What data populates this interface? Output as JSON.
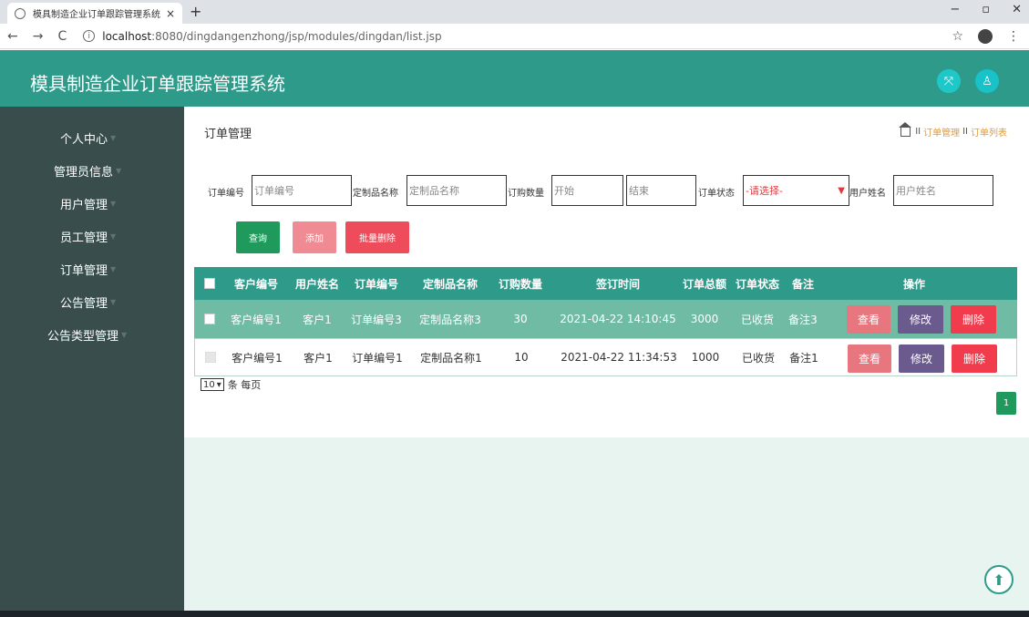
{
  "browser": {
    "tab_title": "模具制造企业订单跟踪管理系统",
    "tab_close": "×",
    "new_tab": "+",
    "url_host": "localhost",
    "url_rest": ":8080/dingdangenzhong/jsp/modules/dingdan/list.jsp",
    "win_min": "−",
    "win_max": "▫",
    "win_close": "✕"
  },
  "header": {
    "title": "模具制造企业订单跟踪管理系统"
  },
  "sidebar": {
    "items": [
      {
        "label": "个人中心"
      },
      {
        "label": "管理员信息"
      },
      {
        "label": "用户管理"
      },
      {
        "label": "员工管理"
      },
      {
        "label": "订单管理"
      },
      {
        "label": "公告管理"
      },
      {
        "label": "公告类型管理"
      }
    ]
  },
  "page": {
    "title": "订单管理",
    "breadcrumb": [
      "订单管理",
      "订单列表"
    ],
    "breadcrumb_sep": "II"
  },
  "filters": {
    "order_no_label": "订单编号",
    "order_no_placeholder": "订单编号",
    "product_label": "定制品名称",
    "product_placeholder": "定制品名称",
    "qty_label": "订购数量",
    "qty_start": "开始",
    "qty_end": "结束",
    "status_label": "订单状态",
    "status_value": "-请选择-",
    "user_label": "用户姓名",
    "user_placeholder": "用户姓名"
  },
  "buttons": {
    "search": "查询",
    "add": "添加",
    "bulk_delete": "批量删除"
  },
  "table": {
    "headers": [
      "客户编号",
      "用户姓名",
      "订单编号",
      "定制品名称",
      "订购数量",
      "签订时间",
      "订单总额",
      "订单状态",
      "备注",
      "操作"
    ],
    "rows": [
      [
        "客户编号1",
        "客户1",
        "订单编号3",
        "定制品名称3",
        "30",
        "2021-04-22 14:10:45",
        "3000",
        "已收货",
        "备注3"
      ],
      [
        "客户编号1",
        "客户1",
        "订单编号1",
        "定制品名称1",
        "10",
        "2021-04-22 11:34:53",
        "1000",
        "已收货",
        "备注1"
      ]
    ],
    "actions": {
      "view": "查看",
      "edit": "修改",
      "delete": "删除"
    }
  },
  "pagination": {
    "page_size": "10",
    "page_size_suffix": "条 每页",
    "current_page": "1"
  }
}
